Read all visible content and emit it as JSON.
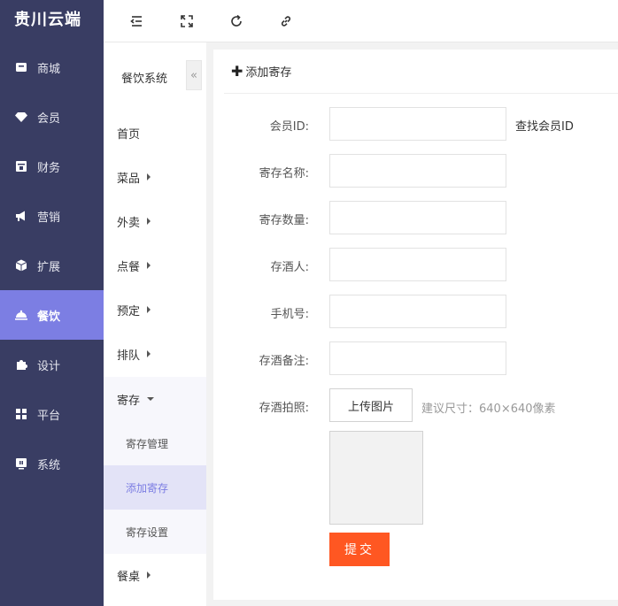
{
  "brand": "贵川云端",
  "main_nav": [
    {
      "label": "商城",
      "icon": "store-icon"
    },
    {
      "label": "会员",
      "icon": "gem-icon"
    },
    {
      "label": "财务",
      "icon": "wallet-icon"
    },
    {
      "label": "营销",
      "icon": "megaphone-icon"
    },
    {
      "label": "扩展",
      "icon": "cube-icon"
    },
    {
      "label": "餐饮",
      "icon": "food-cover-icon",
      "active": true
    },
    {
      "label": "设计",
      "icon": "puzzle-icon"
    },
    {
      "label": "平台",
      "icon": "grid-icon"
    },
    {
      "label": "系统",
      "icon": "monitor-icon"
    }
  ],
  "topbar": {
    "icons": [
      "menu-fold-icon",
      "fullscreen-icon",
      "refresh-icon",
      "link-icon"
    ]
  },
  "sub_nav": {
    "title": "餐饮系统",
    "collapse": "«",
    "items": [
      {
        "label": "首页"
      },
      {
        "label": "菜品"
      },
      {
        "label": "外卖"
      },
      {
        "label": "点餐"
      },
      {
        "label": "预定"
      },
      {
        "label": "排队"
      },
      {
        "label": "寄存"
      },
      {
        "label": "餐桌"
      }
    ],
    "children": [
      {
        "label": "寄存管理"
      },
      {
        "label": "添加寄存",
        "active": true
      },
      {
        "label": "寄存设置"
      }
    ]
  },
  "card": {
    "title": "添加寄存",
    "plus": "✚",
    "fields": [
      {
        "label": "会员ID:",
        "value": ""
      },
      {
        "label": "寄存名称:",
        "value": ""
      },
      {
        "label": "寄存数量:",
        "value": ""
      },
      {
        "label": "存酒人:",
        "value": ""
      },
      {
        "label": "手机号:",
        "value": ""
      },
      {
        "label": "存酒备注:",
        "value": ""
      }
    ],
    "find_member": "查找会员ID",
    "photo_label": "存酒拍照:",
    "upload_label": "上传图片",
    "upload_hint": "建议尺寸：640×640像素",
    "submit_label": "提交"
  },
  "colors": {
    "nav_bg": "#393d63",
    "nav_active": "#7c7ee3",
    "submit": "#ff5722"
  }
}
